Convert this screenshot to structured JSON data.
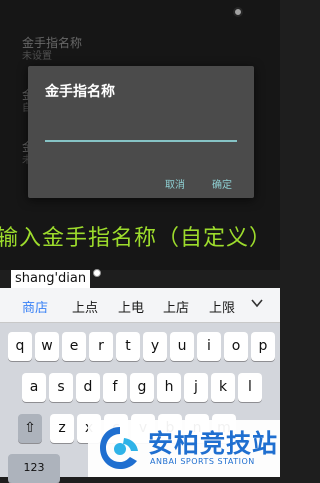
{
  "settings": {
    "items": [
      {
        "title": "金手指名称",
        "subtitle": "未设置"
      },
      {
        "title": "金",
        "subtitle": "自"
      },
      {
        "title": "金",
        "subtitle": "未"
      }
    ]
  },
  "dialog": {
    "title": "金手指名称",
    "input_value": "",
    "cancel_label": "取消",
    "ok_label": "确定"
  },
  "caption": "输入金手指名称（自定义）",
  "ime": {
    "composition": "shang'dian",
    "candidates": [
      "商店",
      "上点",
      "上电",
      "上店",
      "上限"
    ],
    "rows": [
      [
        "q",
        "w",
        "e",
        "r",
        "t",
        "y",
        "u",
        "i",
        "o",
        "p"
      ],
      [
        "a",
        "s",
        "d",
        "f",
        "g",
        "h",
        "j",
        "k",
        "l"
      ],
      [
        "⇧",
        "z",
        "x",
        "c",
        "v",
        "b",
        "n",
        "m"
      ]
    ],
    "fourth_row": [
      "123"
    ]
  },
  "watermark": {
    "cn": "安柏竞技站",
    "en": "ANBAI SPORTS STATION"
  },
  "colors": {
    "accent": "#86c3c5",
    "caption": "#9ddc2c",
    "candidate_active": "#3a82f6",
    "brand": "#1f6fd0"
  }
}
